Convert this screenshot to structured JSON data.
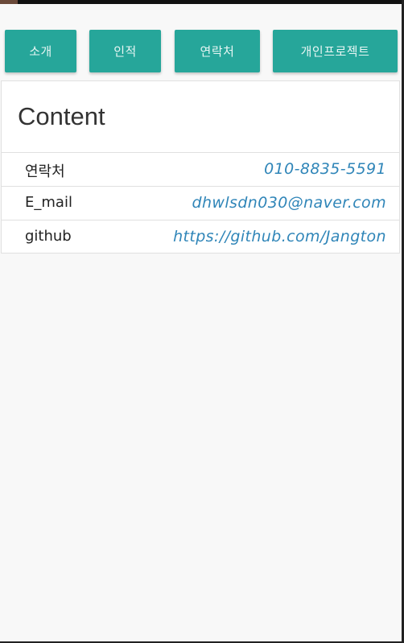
{
  "nav": {
    "items": [
      {
        "label": "소개"
      },
      {
        "label": "인적"
      },
      {
        "label": "연락처"
      },
      {
        "label": "개인프로젝트"
      }
    ],
    "button_color": "#26a69a"
  },
  "card": {
    "title": "Content",
    "rows": [
      {
        "label": "연락처",
        "value": "010-8835-5591"
      },
      {
        "label": "E_mail",
        "value": "dhwlsdn030@naver.com"
      },
      {
        "label": "github",
        "value": "https://github.com/Jangton"
      }
    ],
    "value_color": "#2f85b8"
  }
}
